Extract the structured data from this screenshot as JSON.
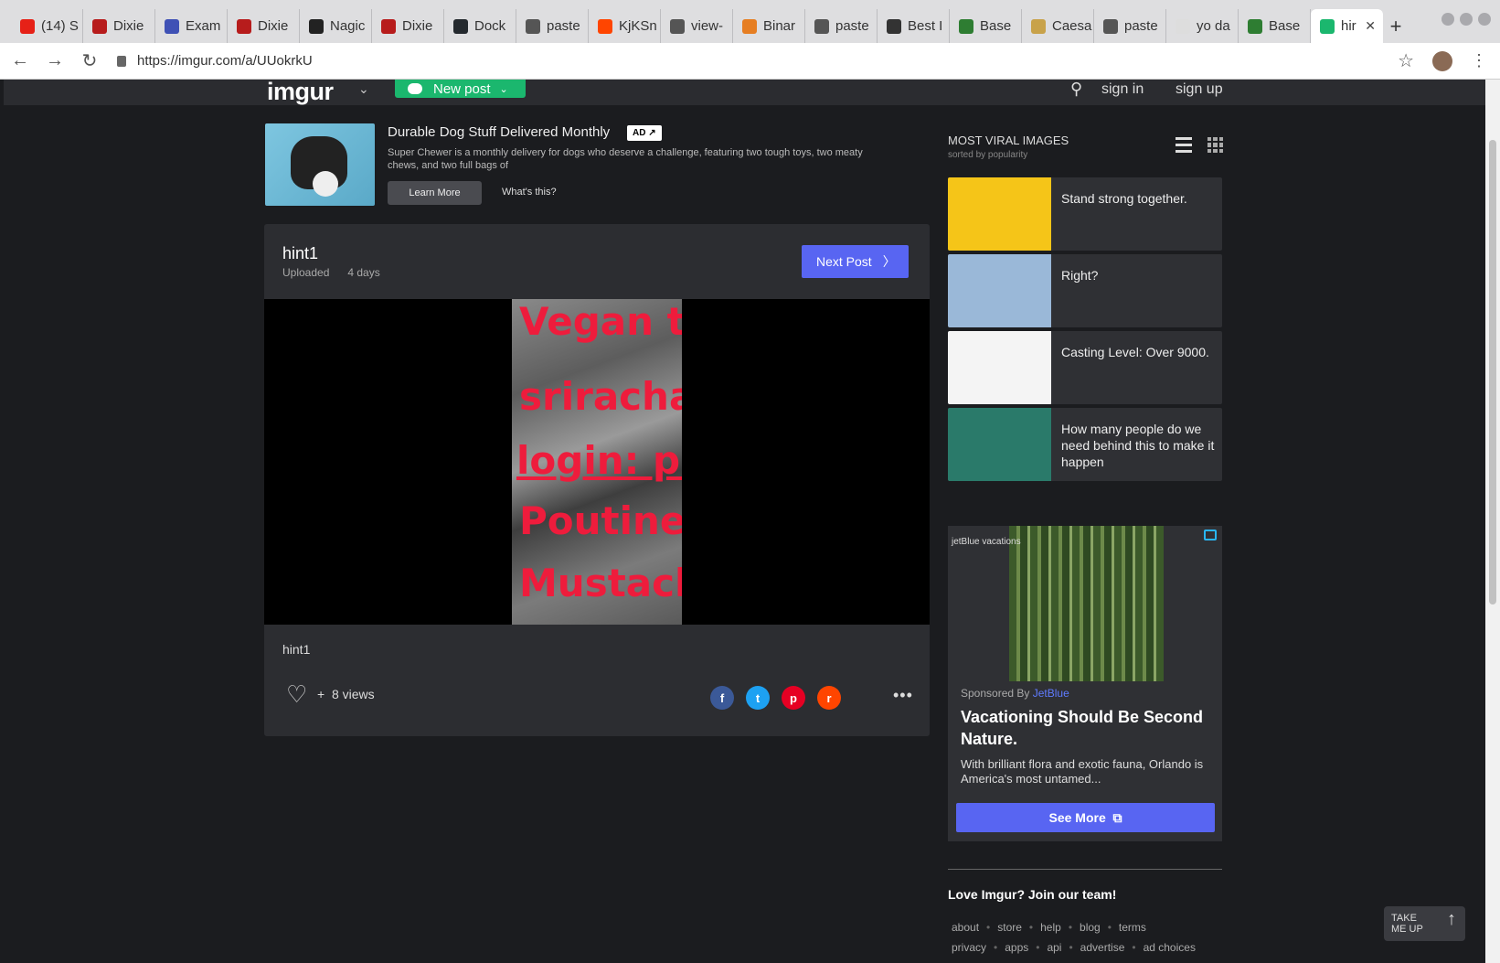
{
  "browser": {
    "tabs": [
      {
        "label": "(14) S",
        "icon_color": "#e62117",
        "icon": "youtube-icon"
      },
      {
        "label": "Dixie",
        "icon_color": "#b71c1c",
        "icon": "dixie-icon"
      },
      {
        "label": "Exam",
        "icon_color": "#3f51b5",
        "icon": "kubernetes-icon"
      },
      {
        "label": "Dixie",
        "icon_color": "#b71c1c",
        "icon": "dixie-icon"
      },
      {
        "label": "Nagic",
        "icon_color": "#222222",
        "icon": "graduation-cap-icon"
      },
      {
        "label": "Dixie",
        "icon_color": "#b71c1c",
        "icon": "dixie-icon"
      },
      {
        "label": "Dock",
        "icon_color": "#24292e",
        "icon": "github-icon"
      },
      {
        "label": "paste",
        "icon_color": "#555555",
        "icon": "pastebin-icon"
      },
      {
        "label": "KjKSn",
        "icon_color": "#ff4500",
        "icon": "reddit-icon"
      },
      {
        "label": "view-",
        "icon_color": "#555555",
        "icon": "pastebin-icon"
      },
      {
        "label": "Binar",
        "icon_color": "#e67e22",
        "icon": "r-icon"
      },
      {
        "label": "paste",
        "icon_color": "#555555",
        "icon": "pastebin-icon"
      },
      {
        "label": "Best I",
        "icon_color": "#333333",
        "icon": "cb-icon"
      },
      {
        "label": "Base",
        "icon_color": "#2e7d32",
        "icon": "base64-icon"
      },
      {
        "label": "Caesa",
        "icon_color": "#c8a24a",
        "icon": "caesar-icon"
      },
      {
        "label": "paste",
        "icon_color": "#555555",
        "icon": "pastebin-icon"
      },
      {
        "label": "yo da",
        "icon_color": "#dddddd",
        "icon": "document-icon"
      },
      {
        "label": "Base",
        "icon_color": "#2e7d32",
        "icon": "base64-icon"
      },
      {
        "label": "hir",
        "icon_color": "#1bb76e",
        "icon": "imgur-icon",
        "active": true
      }
    ],
    "url": "https://imgur.com/a/UUokrkU"
  },
  "header": {
    "logo": "imgur",
    "new_post": "New post",
    "sign_in": "sign in",
    "sign_up": "sign up"
  },
  "ad": {
    "title": "Durable Dog Stuff Delivered Monthly",
    "badge": "AD ↗",
    "description": "Super Chewer is a monthly delivery for dogs who deserve a challenge, featuring two tough toys, two meaty chews, and two full bags of",
    "learn_more": "Learn More",
    "whats_this": "What's this?"
  },
  "post": {
    "title": "hint1",
    "uploaded_label": "Uploaded",
    "age": "4 days",
    "next_post": "Next Post",
    "image_lines": [
      "Vegan ty",
      "sriracha",
      "login: pl",
      "Poutine",
      "Mustach"
    ],
    "caption": "hint1",
    "plus": "+",
    "views": "8 views",
    "share": [
      {
        "name": "facebook",
        "glyph": "f",
        "color": "#3b5998"
      },
      {
        "name": "twitter",
        "glyph": "t",
        "color": "#1da1f2"
      },
      {
        "name": "pinterest",
        "glyph": "p",
        "color": "#e60023"
      },
      {
        "name": "reddit",
        "glyph": "r",
        "color": "#ff4500"
      }
    ],
    "more": "•••"
  },
  "sidebar": {
    "title": "MOST VIRAL IMAGES",
    "subtitle": "sorted by popularity",
    "items": [
      {
        "text": "Stand strong together.",
        "thumb_color": "#f5c518"
      },
      {
        "text": "Right?",
        "thumb_color": "#9ab8d8"
      },
      {
        "text": "Casting Level: Over 9000.",
        "thumb_color": "#f4f4f4"
      },
      {
        "text": "How many people do we need behind this to make it happen",
        "thumb_color": "#2a7a6a"
      }
    ],
    "sponsored": {
      "brand": "jetBlue vacations",
      "by_label": "Sponsored By",
      "by_name": "JetBlue",
      "headline": "Vacationing Should Be Second Nature.",
      "body": "With brilliant flora and exotic fauna, Orlando is America's most untamed...",
      "cta": "See More"
    },
    "join": "Love Imgur? Join our team!",
    "footer_row1": [
      "about",
      "store",
      "help",
      "blog",
      "terms"
    ],
    "footer_row2": [
      "privacy",
      "apps",
      "api",
      "advertise",
      "ad choices"
    ]
  },
  "take_me_up": "TAKE ME UP"
}
